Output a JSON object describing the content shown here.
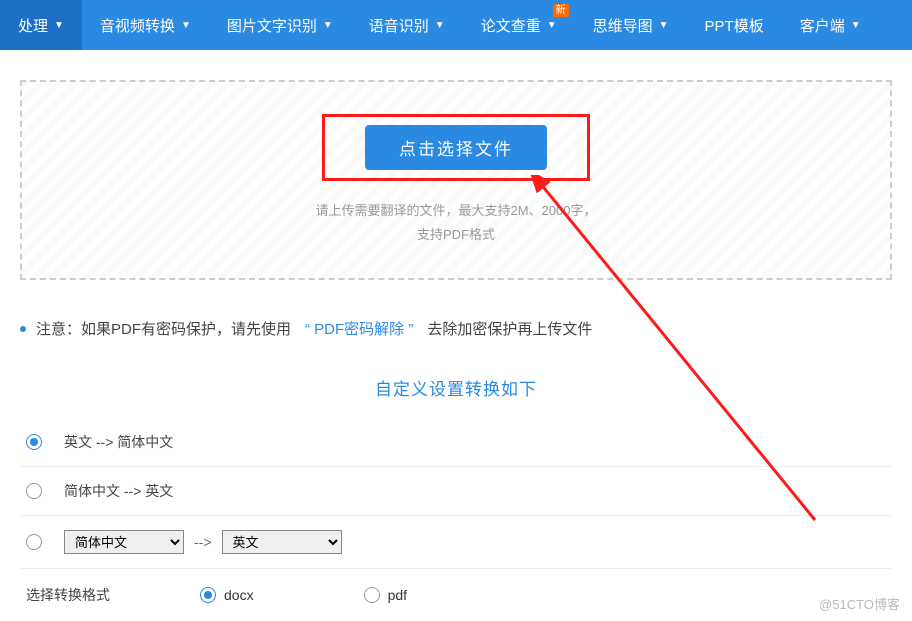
{
  "nav": {
    "items": [
      {
        "label": "处理"
      },
      {
        "label": "音视频转换"
      },
      {
        "label": "图片文字识别"
      },
      {
        "label": "语音识别"
      },
      {
        "label": "论文查重",
        "badge": "新"
      },
      {
        "label": "思维导图"
      },
      {
        "label": "PPT模板"
      },
      {
        "label": "客户端"
      }
    ]
  },
  "upload": {
    "button": "点击选择文件",
    "hint_line1": "请上传需要翻译的文件，最大支持2M、2000字，",
    "hint_line2": "支持PDF格式"
  },
  "notice": {
    "prefix": "注意：如果PDF有密码保护，请先使用",
    "link": "“ PDF密码解除 ”",
    "suffix": "去除加密保护再上传文件"
  },
  "custom": {
    "title": "自定义设置转换如下",
    "opt1": "英文 --> 简体中文",
    "opt2": "简体中文 --> 英文",
    "sel_from": "简体中文",
    "sel_to": "英文",
    "arrow": "-->"
  },
  "format": {
    "title": "选择转换格式",
    "docx": "docx",
    "pdf": "pdf"
  },
  "watermark": "@51CTO博客"
}
